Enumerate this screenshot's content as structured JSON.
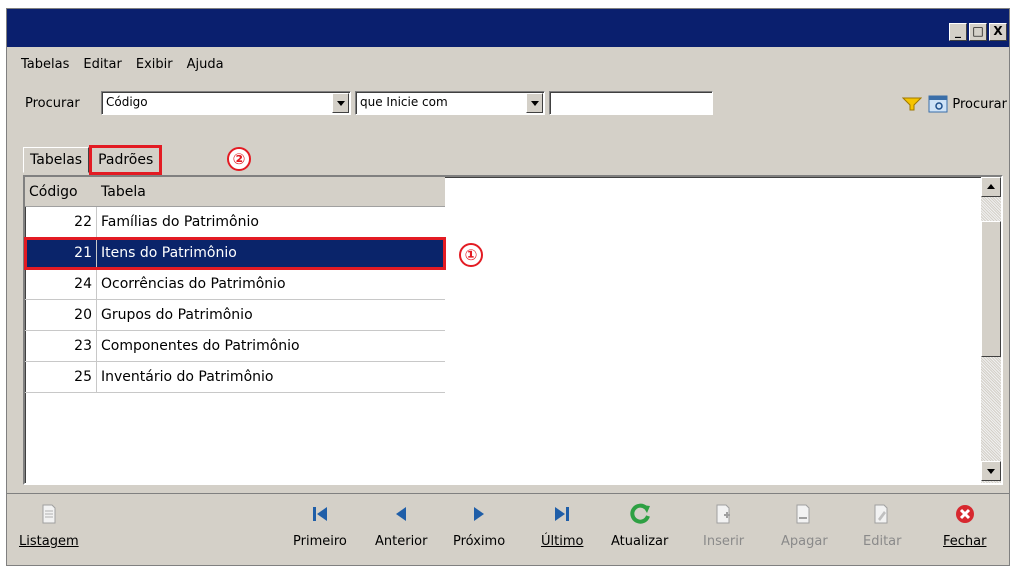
{
  "menu": [
    "Tabelas",
    "Editar",
    "Exibir",
    "Ajuda"
  ],
  "search": {
    "label": "Procurar",
    "field": "Código",
    "mode": "que Inicie com",
    "value": "",
    "button": "Procurar"
  },
  "tabs": [
    "Tabelas",
    "Padrões"
  ],
  "callouts": [
    "①",
    "②"
  ],
  "table": {
    "headers": [
      "Código",
      "Tabela"
    ],
    "rows": [
      {
        "code": "22",
        "name": "Famílias do Patrimônio"
      },
      {
        "code": "21",
        "name": "Itens do Patrimônio"
      },
      {
        "code": "24",
        "name": "Ocorrências do Patrimônio"
      },
      {
        "code": "20",
        "name": "Grupos do Patrimônio"
      },
      {
        "code": "23",
        "name": "Componentes do Patrimônio"
      },
      {
        "code": "25",
        "name": "Inventário do Patrimônio"
      }
    ]
  },
  "toolbar": {
    "listagem": "Listagem",
    "primeiro": "Primeiro",
    "anterior": "Anterior",
    "proximo": "Próximo",
    "ultimo": "Último",
    "atualizar": "Atualizar",
    "inserir": "Inserir",
    "apagar": "Apagar",
    "editar": "Editar",
    "fechar": "Fechar"
  },
  "window_buttons": [
    "_",
    "□",
    "X"
  ]
}
